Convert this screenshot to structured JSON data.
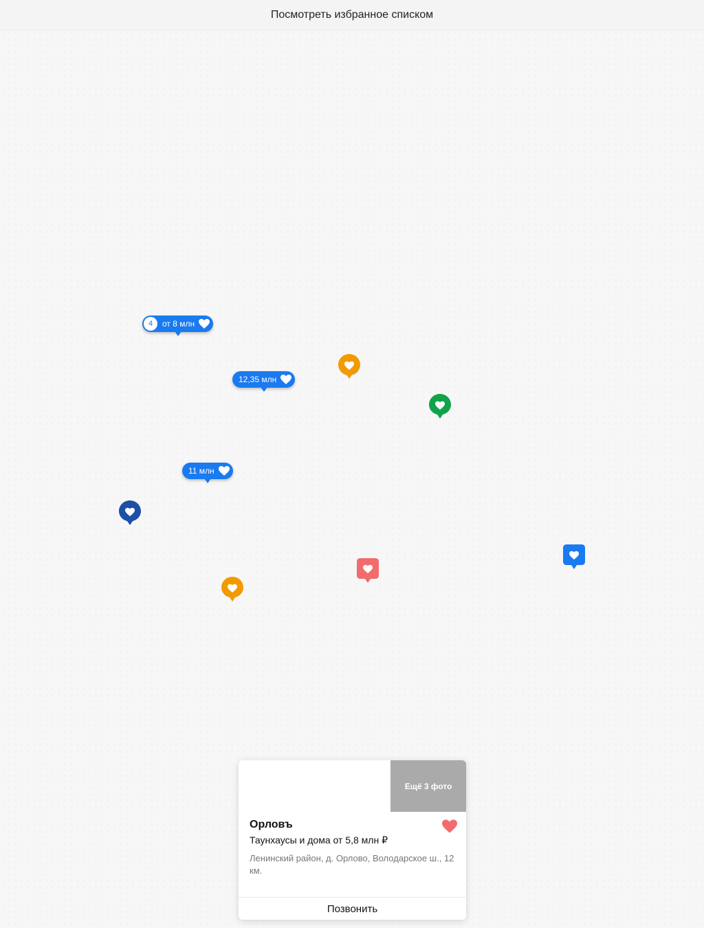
{
  "header": {
    "list_view_link": "Посмотреть избранное списком"
  },
  "colors": {
    "blue": "#1a7aef",
    "orange": "#f39a00",
    "green": "#10a34a",
    "navy": "#1e4fa8",
    "coral": "#f36b6b"
  },
  "markers": {
    "cluster": {
      "count": "4",
      "price": "от 8 млн"
    },
    "price_1": {
      "price": "12,35 млн"
    },
    "price_2": {
      "price": "11 млн"
    }
  },
  "card": {
    "more_photos": "Ещё 3 фото",
    "title": "Орловъ",
    "subtitle": "Таунхаусы и дома от 5,8 млн ₽",
    "address": "Ленинский район, д. Орлово, Володарское ш., 12 км.",
    "call_label": "Позвонить",
    "favorite_icon": "heart-icon"
  }
}
